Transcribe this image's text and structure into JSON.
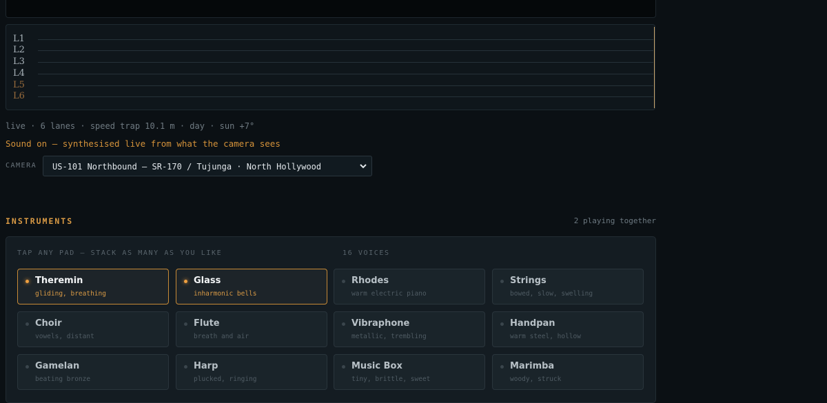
{
  "lanes": [
    "L1",
    "L2",
    "L3",
    "L4",
    "L5",
    "L6"
  ],
  "status_line": "live · 6 lanes · speed trap 10.1 m · day · sun +7°",
  "sound_line": "Sound on — synthesised live from what the camera sees",
  "camera": {
    "label": "CAMERA",
    "selected": "US-101 Northbound — SR-170 / Tujunga · North Hollywood"
  },
  "instruments": {
    "title": "INSTRUMENTS",
    "count_text": "2 playing together",
    "hint": "TAP ANY PAD — STACK AS MANY AS YOU LIKE",
    "voices": "16 VOICES",
    "pads": [
      {
        "name": "Theremin",
        "desc": "gliding, breathing",
        "active": true
      },
      {
        "name": "Glass",
        "desc": "inharmonic bells",
        "active": true
      },
      {
        "name": "Rhodes",
        "desc": "warm electric piano",
        "active": false
      },
      {
        "name": "Strings",
        "desc": "bowed, slow, swelling",
        "active": false
      },
      {
        "name": "Choir",
        "desc": "vowels, distant",
        "active": false
      },
      {
        "name": "Flute",
        "desc": "breath and air",
        "active": false
      },
      {
        "name": "Vibraphone",
        "desc": "metallic, trembling",
        "active": false
      },
      {
        "name": "Handpan",
        "desc": "warm steel, hollow",
        "active": false
      },
      {
        "name": "Gamelan",
        "desc": "beating bronze",
        "active": false
      },
      {
        "name": "Harp",
        "desc": "plucked, ringing",
        "active": false
      },
      {
        "name": "Music Box",
        "desc": "tiny, brittle, sweet",
        "active": false
      },
      {
        "name": "Marimba",
        "desc": "woody, struck",
        "active": false
      }
    ]
  }
}
